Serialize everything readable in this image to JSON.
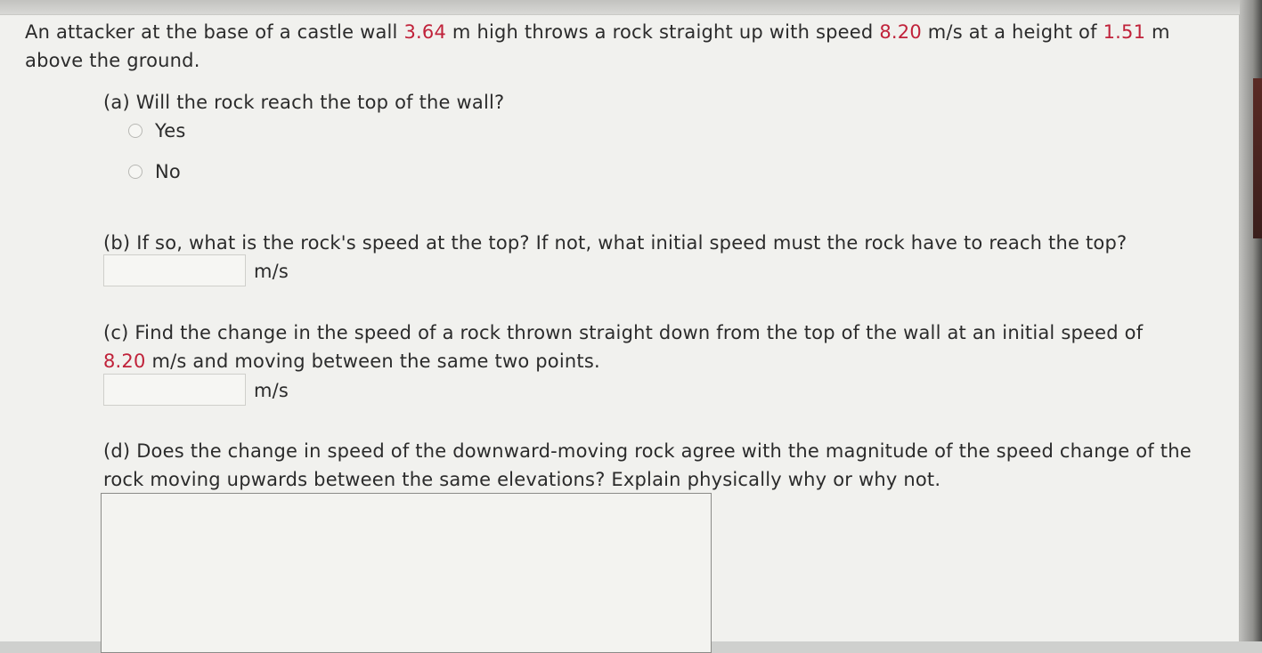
{
  "problem": {
    "t1": "An attacker at the base of a castle wall ",
    "wall_height": "3.64",
    "t2": " m high throws a rock straight up with speed ",
    "speed": "8.20",
    "t3": " m/s at a height of ",
    "throw_height": "1.51",
    "t4": " m",
    "t5": "above the ground."
  },
  "part_a": {
    "question": "(a) Will the rock reach the top of the wall?",
    "options": [
      "Yes",
      "No"
    ]
  },
  "part_b": {
    "question": "(b) If so, what is the rock's speed at the top? If not, what initial speed must the rock have to reach the top?",
    "unit": "m/s",
    "value": ""
  },
  "part_c": {
    "t1": "(c) Find the change in the speed of a rock thrown straight down from the top of the wall at an initial speed of",
    "speed": "8.20",
    "t2": " m/s and moving between the same two points.",
    "unit": "m/s",
    "value": ""
  },
  "part_d": {
    "question": "(d) Does the change in speed of the downward-moving rock agree with the magnitude of the speed change of the rock moving upwards between the same elevations? Explain physically why or why not.",
    "value": ""
  }
}
